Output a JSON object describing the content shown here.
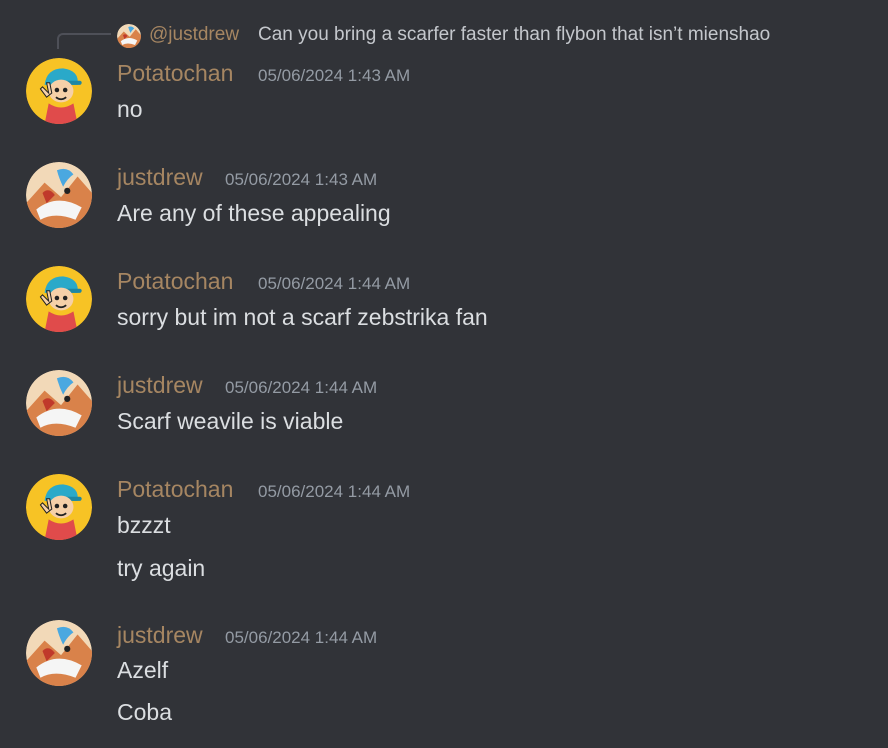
{
  "reply": {
    "author": "@justdrew",
    "text": "Can you bring a scarfer faster than flybon that isn’t mienshao"
  },
  "messages": [
    {
      "author": "Potatochan",
      "timestamp": "05/06/2024 1:43 AM",
      "avatar": "potatochan-avatar",
      "lines": [
        "no"
      ]
    },
    {
      "author": "justdrew",
      "timestamp": "05/06/2024 1:43 AM",
      "avatar": "justdrew-avatar",
      "lines": [
        "Are any of these appealing"
      ]
    },
    {
      "author": "Potatochan",
      "timestamp": "05/06/2024 1:44 AM",
      "avatar": "potatochan-avatar",
      "lines": [
        "sorry but im not a scarf zebstrika fan"
      ]
    },
    {
      "author": "justdrew",
      "timestamp": "05/06/2024 1:44 AM",
      "avatar": "justdrew-avatar",
      "lines": [
        "Scarf weavile is viable"
      ]
    },
    {
      "author": "Potatochan",
      "timestamp": "05/06/2024 1:44 AM",
      "avatar": "potatochan-avatar",
      "lines": [
        "bzzzt",
        "try again"
      ]
    },
    {
      "author": "justdrew",
      "timestamp": "05/06/2024 1:44 AM",
      "avatar": "justdrew-avatar",
      "lines": [
        "Azelf",
        "Coba"
      ]
    }
  ],
  "colors": {
    "background": "#313338",
    "username": "#a68662",
    "timestamp": "#949ba4",
    "message_text": "#dbdee1"
  }
}
